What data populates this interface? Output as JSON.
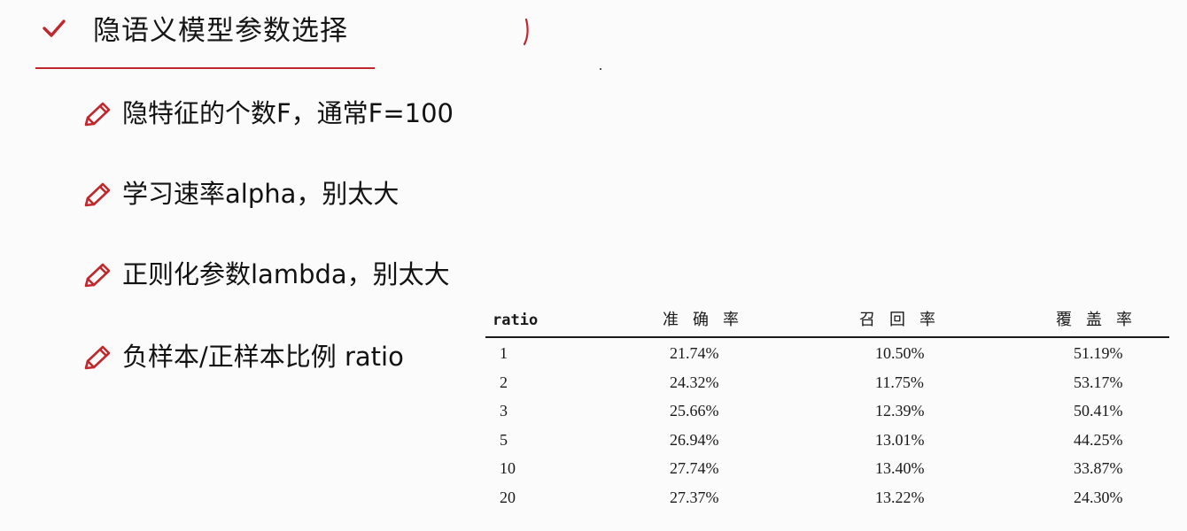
{
  "header": {
    "title": "隐语义模型参数选择"
  },
  "bullets": [
    "隐特征的个数F，通常F=100",
    "学习速率alpha，别太大",
    "正则化参数lambda，别太大",
    "负样本/正样本比例 ratio"
  ],
  "table": {
    "columns": [
      "ratio",
      "准确率",
      "召回率",
      "覆盖率"
    ],
    "rows": [
      [
        "1",
        "21.74%",
        "10.50%",
        "51.19%"
      ],
      [
        "2",
        "24.32%",
        "11.75%",
        "53.17%"
      ],
      [
        "3",
        "25.66%",
        "12.39%",
        "50.41%"
      ],
      [
        "5",
        "26.94%",
        "13.01%",
        "44.25%"
      ],
      [
        "10",
        "27.74%",
        "13.40%",
        "33.87%"
      ],
      [
        "20",
        "27.37%",
        "13.22%",
        "24.30%"
      ]
    ]
  },
  "colors": {
    "accent": "#c0282d",
    "text": "#151515",
    "background": "#fbfbfb"
  },
  "icons": {
    "header": "check-icon",
    "bullet": "pencil-icon"
  }
}
